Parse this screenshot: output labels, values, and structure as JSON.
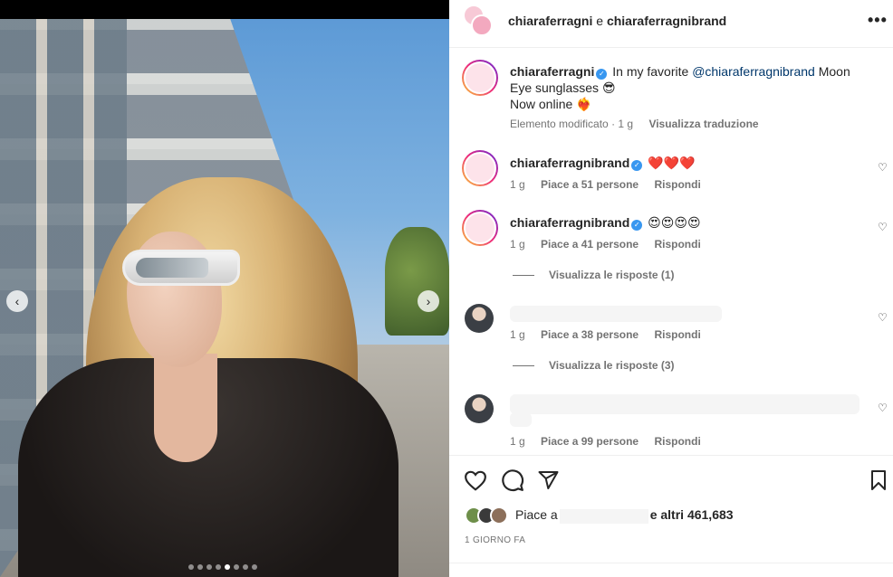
{
  "post": {
    "carousel": {
      "slide_count": 8,
      "active_slide": 5
    }
  },
  "header": {
    "account1": "chiaraferragni",
    "conjunction": "e",
    "account2": "chiaraferragnibrand",
    "more_label": "•••"
  },
  "caption": {
    "username": "chiaraferragni",
    "text_before": "In my favorite",
    "mention": "@chiaraferragnibrand",
    "text_after": "Moon Eye sunglasses 😎",
    "line2": "Now online ❤️‍🔥",
    "edited": "Elemento modificato",
    "time": "1 g",
    "translate": "Visualizza traduzione"
  },
  "comments": [
    {
      "username": "chiaraferragnibrand",
      "text": "❤️❤️❤️",
      "time": "1 g",
      "likes": "Piace a 51 persone",
      "reply": "Rispondi"
    },
    {
      "username": "chiaraferragnibrand",
      "text": "😍😍😍😍",
      "time": "1 g",
      "likes": "Piace a 41 persone",
      "reply": "Rispondi",
      "view_replies": "Visualizza le risposte (1)"
    },
    {
      "username": "",
      "text": "",
      "time": "1 g",
      "likes": "Piace a 38 persone",
      "reply": "Rispondi",
      "view_replies": "Visualizza le risposte (3)"
    },
    {
      "username": "",
      "text": "",
      "time": "1 g",
      "likes": "Piace a 99 persone",
      "reply": "Rispondi"
    }
  ],
  "actions": {
    "likes_prefix": "Piace a",
    "likes_suffix": "e altri",
    "likes_count": "461,683",
    "date": "1 GIORNO FA"
  },
  "icons": [
    "heart-icon",
    "comment-icon",
    "share-icon",
    "bookmark-icon",
    "chevron-left-icon",
    "chevron-right-icon",
    "verified-icon",
    "more-icon"
  ],
  "colors": {
    "verified": "#3897f0",
    "mention": "#00376b",
    "secondary_text": "#737373"
  }
}
